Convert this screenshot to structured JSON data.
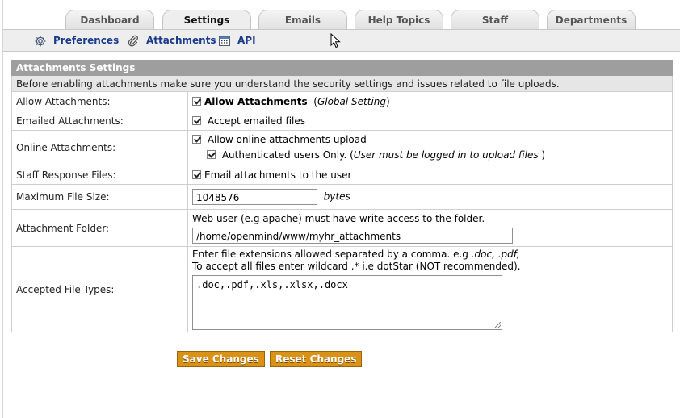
{
  "tabs": [
    {
      "label": "Dashboard",
      "active": false
    },
    {
      "label": "Settings",
      "active": true
    },
    {
      "label": "Emails",
      "active": false
    },
    {
      "label": "Help Topics",
      "active": false
    },
    {
      "label": "Staff",
      "active": false
    },
    {
      "label": "Departments",
      "active": false
    }
  ],
  "subnav": [
    {
      "label": "Preferences",
      "icon": "gear-icon"
    },
    {
      "label": "Attachments",
      "icon": "paperclip-icon"
    },
    {
      "label": "API",
      "icon": "api-icon"
    }
  ],
  "section": {
    "title": "Attachments Settings",
    "intro": "Before enabling attachments make sure you understand the security settings and issues related to file uploads."
  },
  "rows": {
    "allow": {
      "label": "Allow Attachments:",
      "checkbox_label": "Allow Attachments",
      "checked": true,
      "note": "Global Setting"
    },
    "emailed": {
      "label": "Emailed Attachments:",
      "checkbox_label": "Accept emailed files",
      "checked": true
    },
    "online": {
      "label": "Online Attachments:",
      "checkbox_label": "Allow online attachments upload",
      "checked": true,
      "auth_label": "Authenticated users Only.",
      "auth_checked": true,
      "auth_note": "User must be logged in to upload files"
    },
    "staff": {
      "label": "Staff Response Files:",
      "checkbox_label": "Email attachments to the user",
      "checked": true
    },
    "max_size": {
      "label": "Maximum File Size:",
      "value": "1048576",
      "unit": "bytes"
    },
    "folder": {
      "label": "Attachment Folder:",
      "help": "Web user (e.g apache) must have write access to the folder.",
      "value": "/home/openmind/www/myhr_attachments"
    },
    "file_types": {
      "label": "Accepted File Types:",
      "help1_prefix": "Enter file extensions allowed separated by a comma. e.g ",
      "help1_example": ".doc, .pdf,",
      "help2": "To accept all files enter wildcard .* i.e dotStar (NOT recommended).",
      "value": ".doc,.pdf,.xls,.xlsx,.docx"
    }
  },
  "buttons": {
    "save": "Save Changes",
    "reset": "Reset Changes"
  },
  "colors": {
    "link_blue": "#1b3c8a",
    "button_orange": "#d99215",
    "header_gray": "#9e9e9e"
  }
}
